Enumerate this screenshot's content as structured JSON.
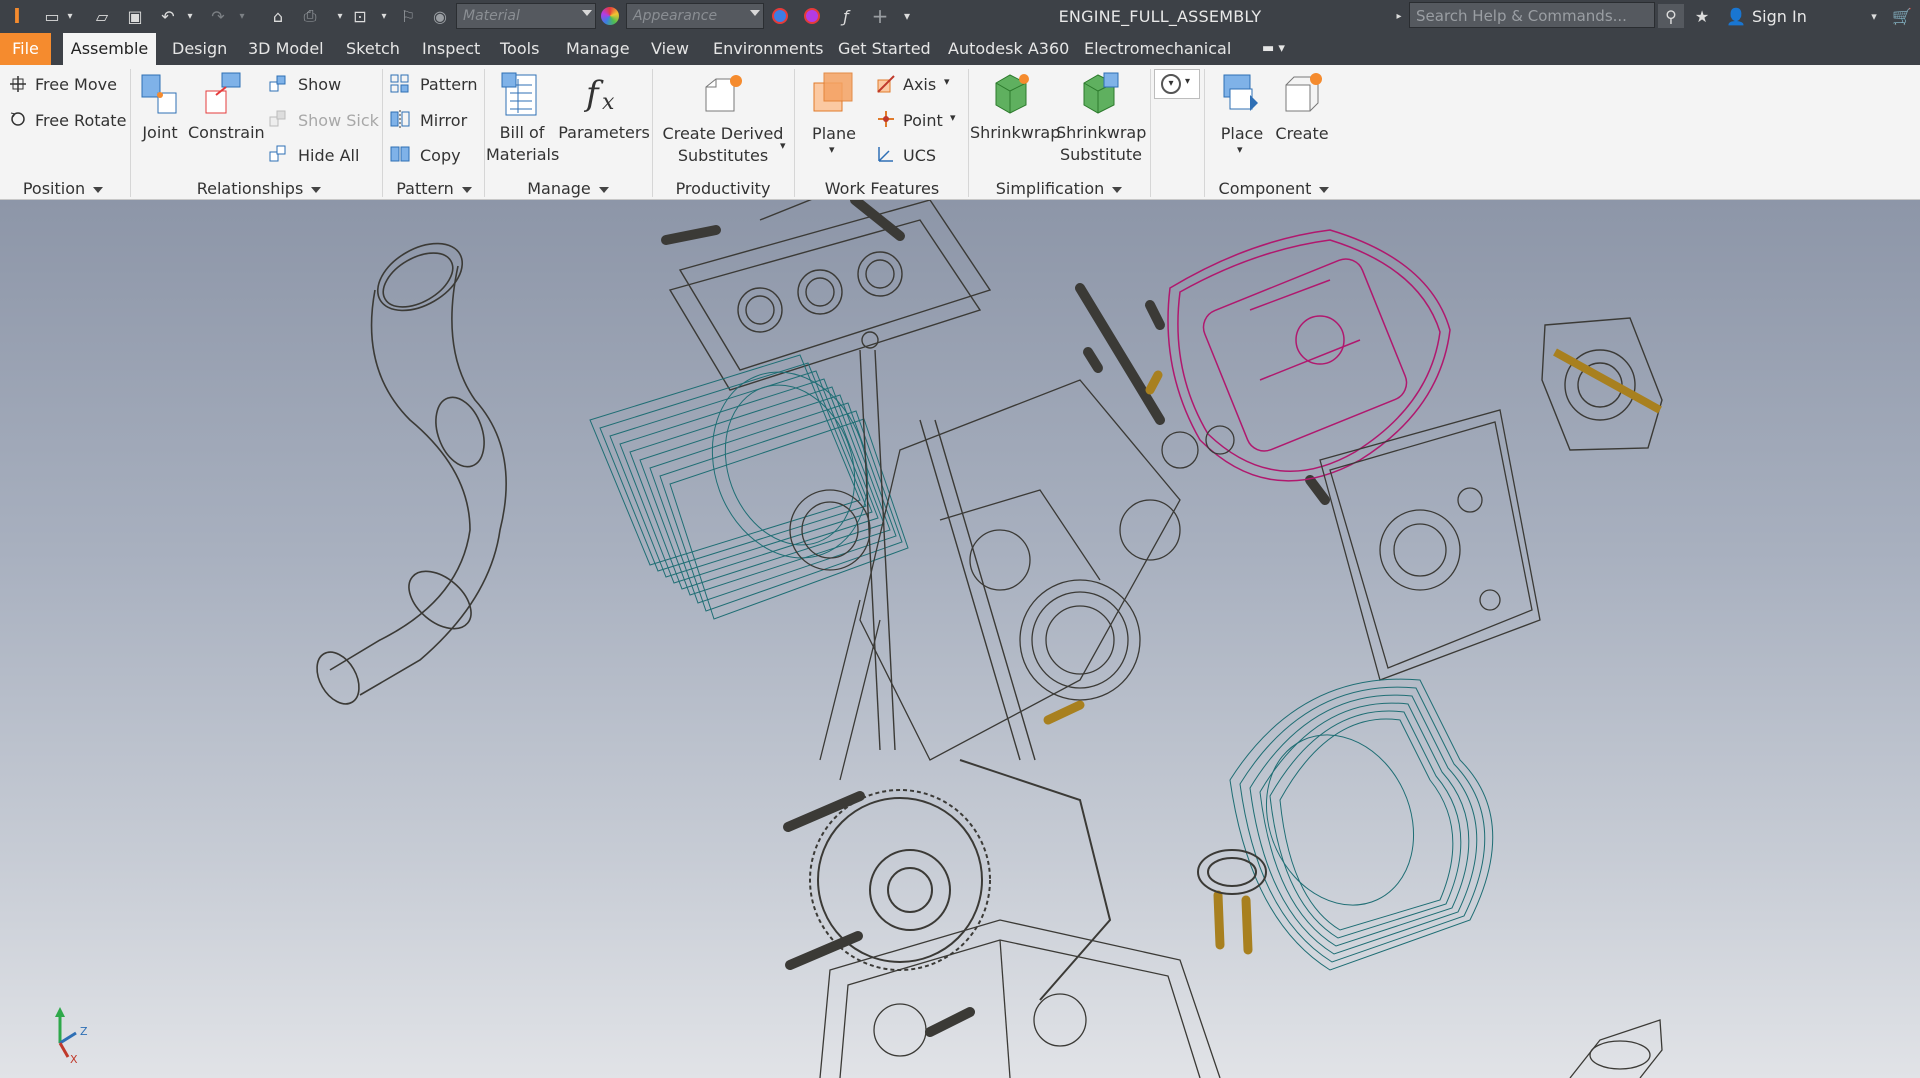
{
  "app": {
    "doc_title": "ENGINE_FULL_ASSEMBLY"
  },
  "quick_access": {
    "material_placeholder": "Material",
    "appearance_placeholder": "Appearance",
    "search_placeholder": "Search Help & Commands...",
    "sign_in": "Sign In"
  },
  "tabs": [
    "File",
    "Assemble",
    "Design",
    "3D Model",
    "Sketch",
    "Inspect",
    "Tools",
    "Manage",
    "View",
    "Environments",
    "Get Started",
    "Autodesk A360",
    "Electromechanical"
  ],
  "ribbon": {
    "position": {
      "free_move": "Free Move",
      "free_rotate": "Free Rotate",
      "label": "Position"
    },
    "relationships": {
      "joint": "Joint",
      "constrain": "Constrain",
      "show": "Show",
      "show_sick": "Show Sick",
      "hide_all": "Hide All",
      "label": "Relationships"
    },
    "pattern": {
      "pattern": "Pattern",
      "mirror": "Mirror",
      "copy": "Copy",
      "label": "Pattern"
    },
    "manage": {
      "bom_line1": "Bill of",
      "bom_line2": "Materials",
      "parameters": "Parameters",
      "label": "Manage"
    },
    "productivity": {
      "line1": "Create Derived",
      "line2": "Substitutes",
      "label": "Productivity"
    },
    "work_features": {
      "plane": "Plane",
      "axis": "Axis",
      "point": "Point",
      "ucs": "UCS",
      "label": "Work Features"
    },
    "simplification": {
      "shrinkwrap": "Shrinkwrap",
      "sub_line1": "Shrinkwrap",
      "sub_line2": "Substitute",
      "label": "Simplification"
    },
    "component": {
      "place": "Place",
      "create": "Create",
      "label": "Component"
    }
  },
  "triad": {
    "z": "Z",
    "x": "X"
  },
  "colors": {
    "menu_bg": "#3d4147",
    "file_tab": "#f58b2e",
    "ribbon_bg": "#f4f4f4",
    "wire_dark": "#3b3a36",
    "wire_teal": "#1f6e74",
    "wire_magenta": "#b0186e",
    "wire_brass": "#a8801f"
  }
}
